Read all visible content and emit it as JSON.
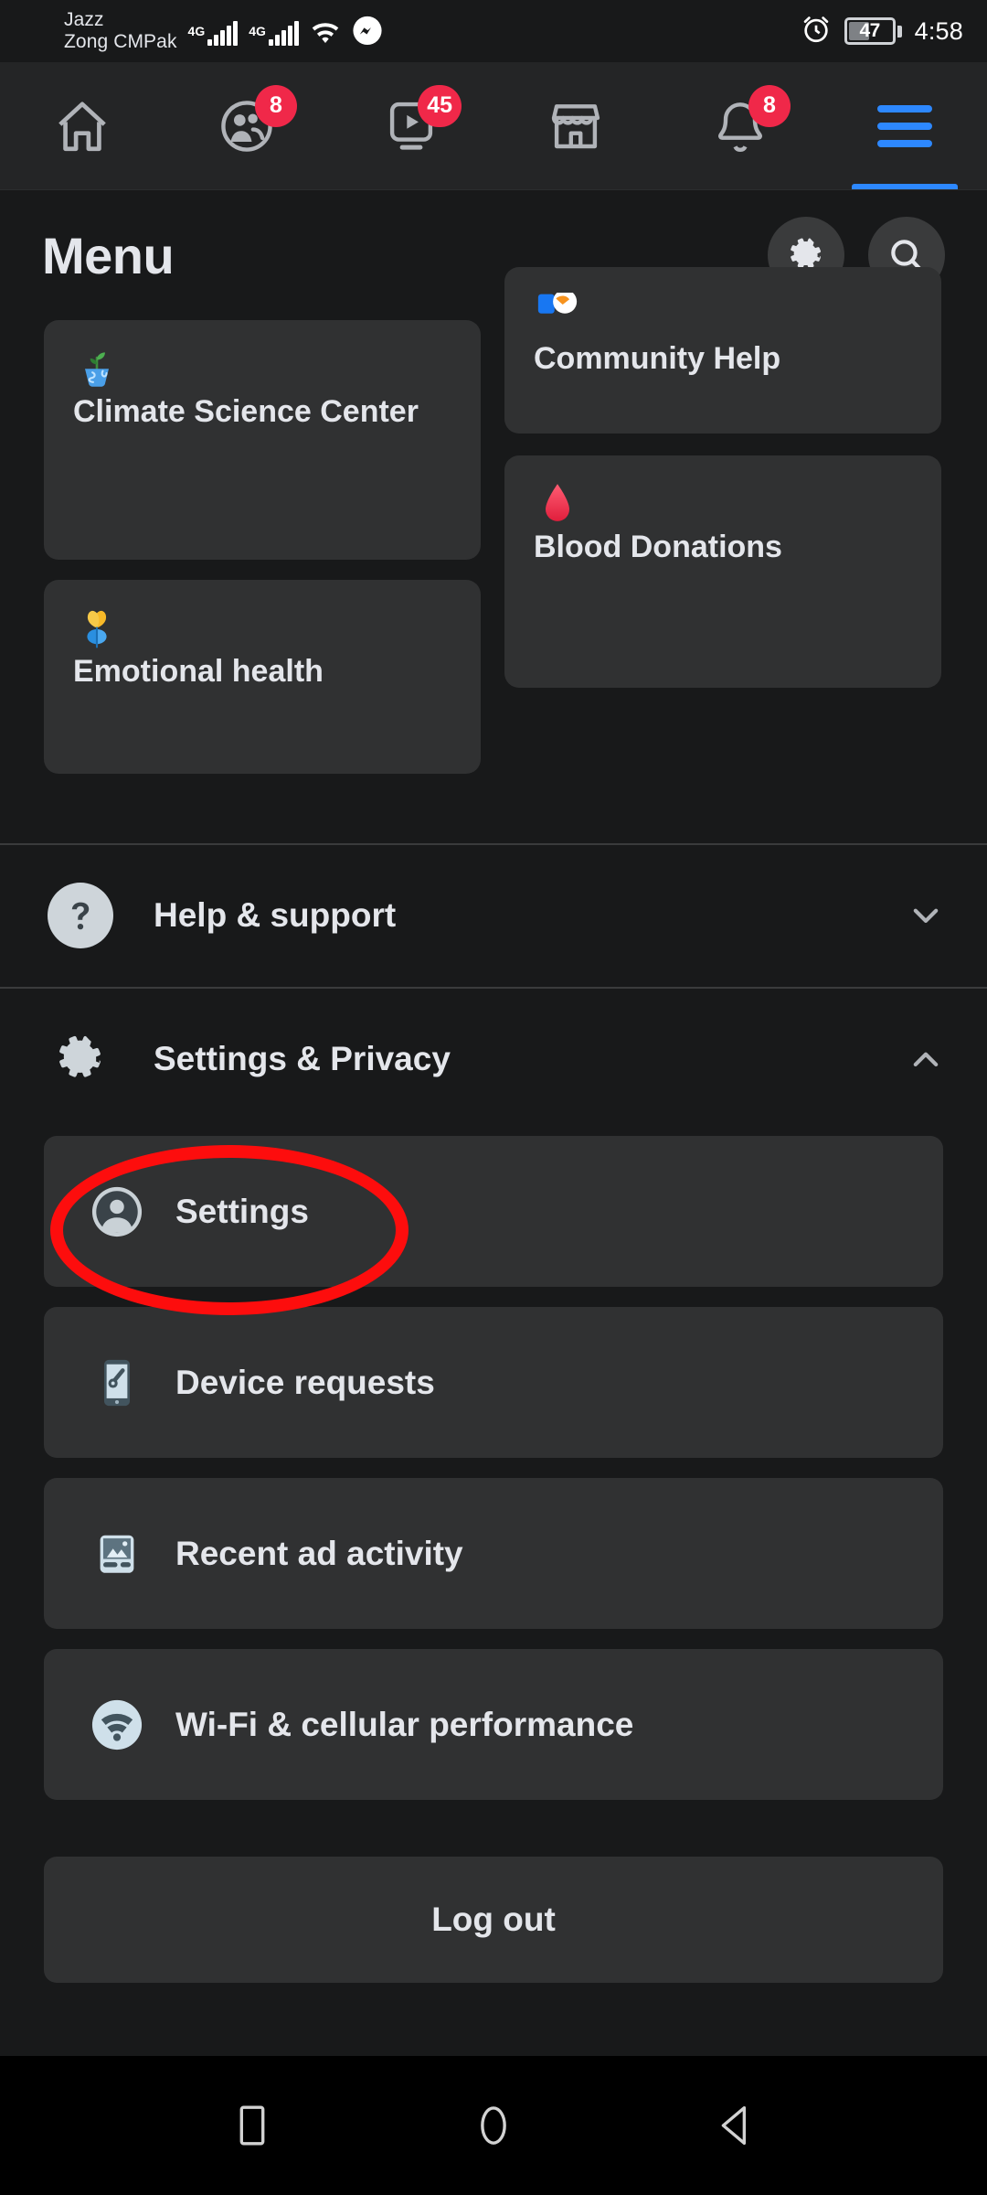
{
  "status_bar": {
    "carrier_line1": "Jazz",
    "carrier_line2": "Zong CMPak",
    "network_1": "4G",
    "network_2": "4G",
    "wifi_icon": "wifi-icon",
    "messenger_icon": "messenger-icon",
    "alarm_icon": "alarm-icon",
    "battery_percent": "47",
    "battery_level": 47,
    "time": "4:58"
  },
  "top_nav": {
    "items": [
      {
        "name": "home",
        "icon": "home-icon",
        "badge": "",
        "active": false
      },
      {
        "name": "friends",
        "icon": "friends-icon",
        "badge": "8",
        "active": false
      },
      {
        "name": "video",
        "icon": "video-icon",
        "badge": "45",
        "active": false
      },
      {
        "name": "marketplace",
        "icon": "marketplace-icon",
        "badge": "",
        "active": false
      },
      {
        "name": "notifications",
        "icon": "bell-icon",
        "badge": "8",
        "active": false
      },
      {
        "name": "menu",
        "icon": "hamburger-icon",
        "badge": "",
        "active": true
      }
    ],
    "badge_color": "#f02849",
    "active_color": "#2d88ff"
  },
  "header": {
    "title": "Menu",
    "settings_button": "gear-icon",
    "search_button": "search-icon"
  },
  "shortcuts": {
    "left_column": [
      {
        "label": "Climate Science Center",
        "icon": "seedling-globe-icon"
      },
      {
        "label": "Emotional health",
        "icon": "heart-flower-icon"
      }
    ],
    "right_column": [
      {
        "label": "Community Help",
        "icon": "community-help-icon"
      },
      {
        "label": "Blood Donations",
        "icon": "blood-drop-icon"
      }
    ]
  },
  "accordions": [
    {
      "label": "Help & support",
      "icon": "question-mark-icon",
      "chevron": "chevron-down-icon",
      "expanded": false
    },
    {
      "label": "Settings & Privacy",
      "icon": "gear-icon",
      "chevron": "chevron-up-icon",
      "expanded": true
    }
  ],
  "settings_rows": [
    {
      "label": "Settings",
      "icon": "profile-avatar-icon",
      "highlighted": true
    },
    {
      "label": "Device requests",
      "icon": "device-phone-icon",
      "highlighted": false
    },
    {
      "label": "Recent ad activity",
      "icon": "ad-image-icon",
      "highlighted": false
    },
    {
      "label": "Wi-Fi & cellular performance",
      "icon": "wifi-icon",
      "highlighted": false
    }
  ],
  "logout": {
    "label": "Log out"
  },
  "annotation": {
    "type": "red-ellipse-highlight",
    "target": "Settings",
    "color": "#fd0d0d"
  },
  "bottom_nav": [
    {
      "name": "recents",
      "icon": "square-icon"
    },
    {
      "name": "home",
      "icon": "circle-icon"
    },
    {
      "name": "back",
      "icon": "triangle-left-icon"
    }
  ],
  "colors": {
    "page_background": "#18191a",
    "card_background": "#303132",
    "nav_background": "#242526",
    "text_primary": "#e4e6eb",
    "accent_blue": "#2d88ff",
    "badge_red": "#f02849",
    "annotation_red": "#fd0d0d"
  }
}
